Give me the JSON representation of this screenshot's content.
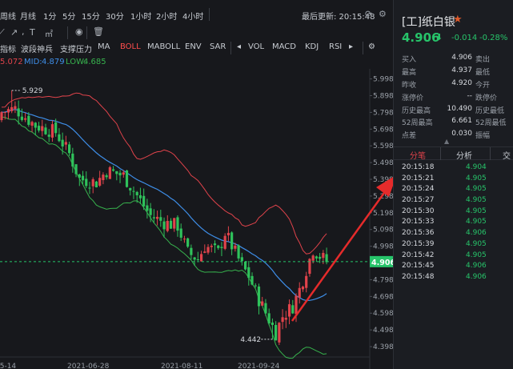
{
  "toolbar": {
    "periods": [
      "周线",
      "月线",
      "1分",
      "5分",
      "15分",
      "30分",
      "1小时",
      "2小时",
      "4小时"
    ],
    "last_update_label": "最后更新: 20:15:48"
  },
  "drawing_tools": {
    "text_tool": "T",
    "draw_label": "㎡"
  },
  "indicator_bar": {
    "items": [
      "指标",
      "波段神兵",
      "支撑压力",
      "MA",
      "BOLL",
      "MABOLL",
      "ENV",
      "SAR",
      "VOL",
      "MACD",
      "KDJ",
      "RSI"
    ],
    "active": "BOLL",
    "active_color": "#ff4d4d"
  },
  "boll_legend": {
    "up_value": "5.072",
    "mid_label": "MID:",
    "mid_value": "4.879",
    "low_label": "LOW:",
    "low_value": "4.685",
    "up_color": "#e0434b",
    "mid_color": "#3e8ee8",
    "low_color": "#37b24d"
  },
  "chart_data": {
    "type": "candlestick",
    "y_ticks": [
      "5.998",
      "5.898",
      "5.798",
      "5.698",
      "5.598",
      "5.498",
      "5.398",
      "5.298",
      "5.198",
      "5.098",
      "4.998",
      "4.898",
      "4.798",
      "4.698",
      "4.598",
      "4.498",
      "4.398"
    ],
    "ylim": [
      4.36,
      6.02
    ],
    "x_ticks": [
      "05-14",
      "2021-06-28",
      "2021-08-11",
      "2021-09-24"
    ],
    "current_price_label": "4.906",
    "high_annotation": "5.929",
    "low_annotation": "4.442",
    "colors": {
      "up": "#e0434b",
      "down": "#2fc25b",
      "upper_band": "#e0434b",
      "mid_band": "#3e8ee8",
      "lower_band": "#37b24d",
      "current_line": "#27c46a",
      "arrow": "#e52b2b"
    }
  },
  "quote": {
    "name": "[工]纸白银",
    "price": "4.906",
    "change": "-0.014",
    "change_pct": "-0.28%",
    "stats": [
      [
        "买入",
        "4.906",
        "卖出",
        ""
      ],
      [
        "最高",
        "4.937",
        "最低",
        ""
      ],
      [
        "昨收",
        "4.920",
        "今开",
        ""
      ],
      [
        "涨停价",
        "--",
        "跌停价",
        ""
      ],
      [
        "历史最高",
        "10.490",
        "历史最低",
        ""
      ],
      [
        "52周最高",
        "6.661",
        "52周最低",
        ""
      ],
      [
        "点差",
        "0.030",
        "振幅",
        ""
      ]
    ],
    "tabs": [
      "分笔",
      "分析",
      "交"
    ],
    "trades": [
      [
        "20:15:18",
        "4.904"
      ],
      [
        "20:15:21",
        "4.905"
      ],
      [
        "20:15:24",
        "4.905"
      ],
      [
        "20:15:27",
        "4.905"
      ],
      [
        "20:15:30",
        "4.905"
      ],
      [
        "20:15:33",
        "4.905"
      ],
      [
        "20:15:36",
        "4.906"
      ],
      [
        "20:15:39",
        "4.905"
      ],
      [
        "20:15:42",
        "4.905"
      ],
      [
        "20:15:45",
        "4.906"
      ],
      [
        "20:15:48",
        "4.906"
      ]
    ]
  }
}
